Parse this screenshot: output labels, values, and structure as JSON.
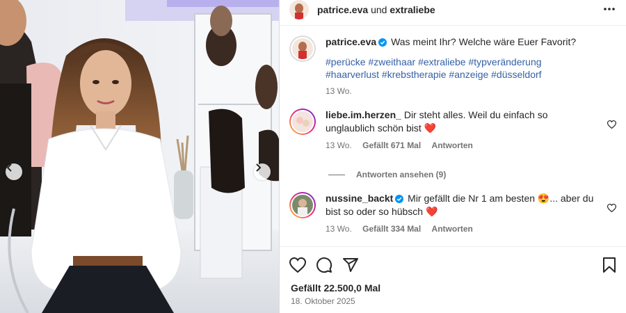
{
  "header": {
    "username": "patrice.eva",
    "connector": "und",
    "collaborator": "extraliebe"
  },
  "caption": {
    "username": "patrice.eva",
    "text": "Was meint Ihr? Welche wäre Euer Favorit?",
    "hashtags": "#perücke #zweithaar #extraliebe #typveränderung #haarverlust #krebstherapie #anzeige #düsseldorf",
    "time": "13 Wo."
  },
  "comments": [
    {
      "username": "liebe.im.herzen_",
      "verified": false,
      "text": "Dir steht alles. Weil du einfach so unglaublich schön bist ❤️",
      "time": "13 Wo.",
      "likes": "Gefällt 671 Mal",
      "reply": "Antworten",
      "view_replies": "Antworten ansehen (9)"
    },
    {
      "username": "nussine_backt",
      "verified": true,
      "text": "Mir gefällt die Nr 1 am besten 😍... aber du bist so oder so hübsch ❤️",
      "time": "13 Wo.",
      "likes": "Gefällt 334 Mal",
      "reply": "Antworten"
    }
  ],
  "footer": {
    "likes": "Gefällt 22.500,0 Mal",
    "date": "18. Oktober 2025"
  },
  "icons": {
    "more": "more-horizontal-icon",
    "verified": "verified-badge-icon",
    "like": "heart-icon",
    "comment": "comment-icon",
    "share": "share-icon",
    "save": "bookmark-icon",
    "prev": "chevron-left-icon",
    "next": "chevron-right-icon"
  },
  "colors": {
    "accent_link": "#3461a7",
    "verified_blue": "#0095f6",
    "muted_text": "#737373"
  }
}
